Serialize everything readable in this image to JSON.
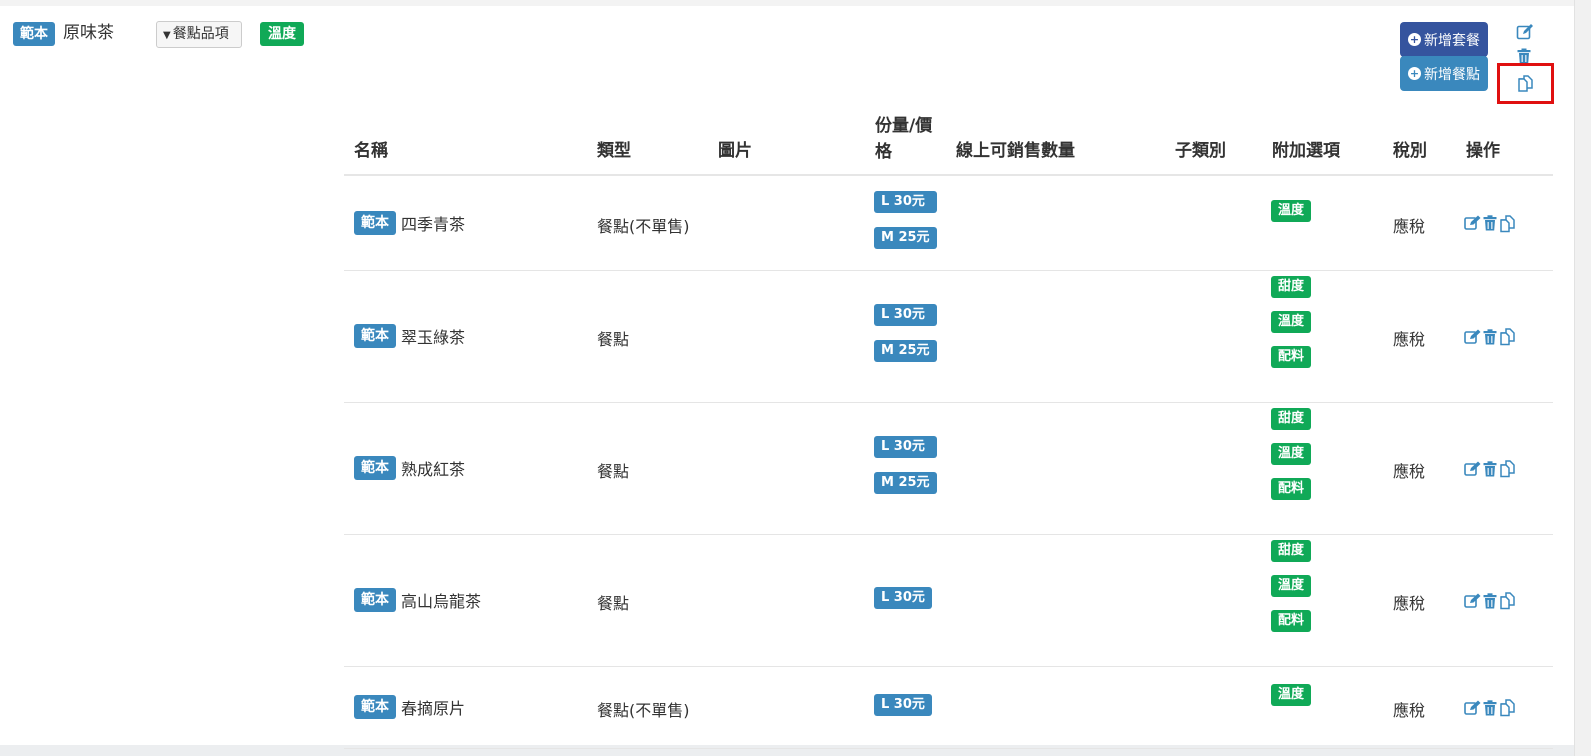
{
  "category": {
    "badge": "範本",
    "name": "原味茶",
    "dropdown_label": "餐點品項",
    "option_tag": "溫度"
  },
  "actions": {
    "add_set_label": "新增套餐",
    "add_item_label": "新增餐點",
    "highlight_color": "#e01010"
  },
  "icons": {
    "edit": "pencil-square-icon",
    "delete": "trash-icon",
    "copy": "copy-icon"
  },
  "table": {
    "headers": {
      "name": "名稱",
      "type": "類型",
      "image": "圖片",
      "portion_price": "份量/價格",
      "online_qty": "線上可銷售數量",
      "subcategory": "子類別",
      "addons": "附加選項",
      "tax": "稅別",
      "ops": "操作"
    },
    "rows": [
      {
        "badge": "範本",
        "name": "四季青茶",
        "type": "餐點(不單售)",
        "prices": [
          "L 30元",
          "M 25元"
        ],
        "addons": [
          "溫度"
        ],
        "tax": "應稅"
      },
      {
        "badge": "範本",
        "name": "翠玉綠茶",
        "type": "餐點",
        "prices": [
          "L 30元",
          "M 25元"
        ],
        "addons": [
          "甜度",
          "溫度",
          "配料"
        ],
        "tax": "應稅"
      },
      {
        "badge": "範本",
        "name": "熟成紅茶",
        "type": "餐點",
        "prices": [
          "L 30元",
          "M 25元"
        ],
        "addons": [
          "甜度",
          "溫度",
          "配料"
        ],
        "tax": "應稅"
      },
      {
        "badge": "範本",
        "name": "高山烏龍茶",
        "type": "餐點",
        "prices": [
          "L 30元"
        ],
        "addons": [
          "甜度",
          "溫度",
          "配料"
        ],
        "tax": "應稅"
      },
      {
        "badge": "範本",
        "name": "春摘原片",
        "type": "餐點(不單售)",
        "prices": [
          "L 30元"
        ],
        "addons": [
          "溫度"
        ],
        "tax": "應稅"
      }
    ]
  }
}
